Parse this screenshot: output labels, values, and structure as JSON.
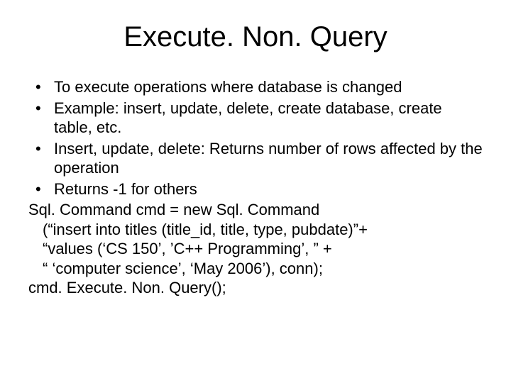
{
  "title": "Execute. Non. Query",
  "bullets": [
    "To execute operations where database is changed",
    "Example: insert, update, delete, create database, create table, etc.",
    "Insert, update, delete: Returns number of rows affected by the operation",
    "Returns -1 for others"
  ],
  "code": {
    "l0": "Sql. Command cmd = new Sql. Command",
    "l1": "(“insert into titles (title_id, title, type, pubdate)”+",
    "l2": "“values (‘CS 150’, ’C++ Programming’, ” +",
    "l3": "“ ‘computer science’, ‘May 2006’), conn);",
    "l4": "cmd. Execute. Non. Query();"
  }
}
